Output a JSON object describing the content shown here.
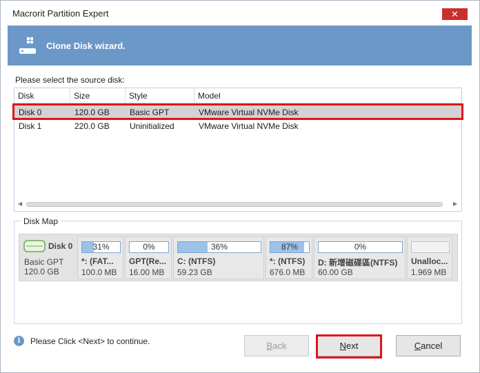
{
  "window": {
    "title": "Macrorit Partition Expert",
    "close_glyph": "✕"
  },
  "banner": {
    "title": "Clone Disk wizard."
  },
  "source": {
    "label": "Please select the source disk:"
  },
  "table": {
    "columns": [
      "Disk",
      "Size",
      "Style",
      "Model"
    ],
    "rows": [
      {
        "disk": "Disk 0",
        "size": "120.0 GB",
        "style": "Basic GPT",
        "model": "VMware Virtual NVMe Disk",
        "selected": true
      },
      {
        "disk": "Disk 1",
        "size": "220.0 GB",
        "style": "Uninitialized",
        "model": "VMware Virtual NVMe Disk",
        "selected": false
      }
    ]
  },
  "disk_map": {
    "legend": "Disk Map",
    "disk": {
      "name": "Disk 0",
      "type": "Basic GPT",
      "size": "120.0 GB"
    },
    "partitions": [
      {
        "usage": "31%",
        "fill": 0.31,
        "name": "*: (FAT...",
        "size": "100.0 MB"
      },
      {
        "usage": "0%",
        "fill": 0.0,
        "name": "GPT(Re...",
        "size": "16.00 MB"
      },
      {
        "usage": "36%",
        "fill": 0.36,
        "name": "C: (NTFS)",
        "size": "59.23 GB"
      },
      {
        "usage": "87%",
        "fill": 0.87,
        "name": "*: (NTFS)",
        "size": "676.0 MB"
      },
      {
        "usage": "0%",
        "fill": 0.0,
        "name": "D: 新增磁碟區(NTFS)",
        "size": "60.00 GB"
      },
      {
        "usage": "",
        "fill": 0.0,
        "name": "Unalloc...",
        "size": "1.969 MB"
      }
    ]
  },
  "footer": {
    "info_text": "Please Click <Next> to continue.",
    "back": {
      "mnemonic": "B",
      "rest": "ack",
      "enabled": false
    },
    "next": {
      "mnemonic": "N",
      "rest": "ext",
      "enabled": true
    },
    "cancel": {
      "mnemonic": "C",
      "rest": "ancel",
      "enabled": true
    }
  },
  "colors": {
    "banner": "#6c98c8",
    "highlight": "#e0121a",
    "usage_fill": "#9cc2e8"
  }
}
